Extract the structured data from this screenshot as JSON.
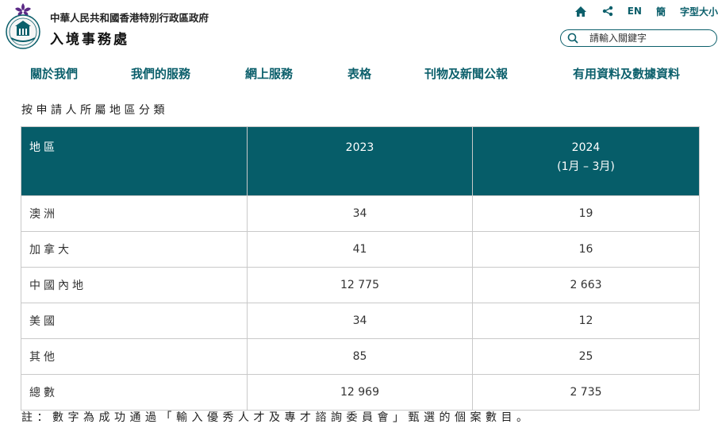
{
  "header": {
    "government_name": "中華人民共和國香港特別行政區政府",
    "department_name": "入境事務處",
    "top_links": {
      "home_icon": "home-icon",
      "share_icon": "share-icon",
      "english": "EN",
      "simplified": "簡",
      "font_size": "字型大小"
    },
    "search": {
      "placeholder": "請輸入關鍵字",
      "value": ""
    }
  },
  "nav": {
    "items": [
      {
        "label": "關於我們"
      },
      {
        "label": "我們的服務"
      },
      {
        "label": "網上服務"
      },
      {
        "label": "表格"
      },
      {
        "label": "刊物及新聞公報"
      },
      {
        "label": "有用資料及數據資料"
      }
    ]
  },
  "main": {
    "section_title": "按申請人所屬地區分類",
    "table": {
      "headers": [
        "地區",
        "2023",
        "2024",
        "(1月 – 3月)"
      ],
      "rows": [
        {
          "region": "澳洲",
          "y2023": "34",
          "y2024": "19"
        },
        {
          "region": "加拿大",
          "y2023": "41",
          "y2024": "16"
        },
        {
          "region": "中國內地",
          "y2023": "12 775",
          "y2024": "2 663"
        },
        {
          "region": "美國",
          "y2023": "34",
          "y2024": "12"
        },
        {
          "region": "其他",
          "y2023": "85",
          "y2024": "25"
        },
        {
          "region": "總數",
          "y2023": "12 969",
          "y2024": "2 735"
        }
      ]
    },
    "note": "註：數字為成功通過「輸入優秀人才及專才諮詢委員會」甄選的個案數目。"
  },
  "colors": {
    "accent": "#0b5f6b",
    "table_header": "#065d69",
    "logo_purple": "#5b2a86"
  }
}
